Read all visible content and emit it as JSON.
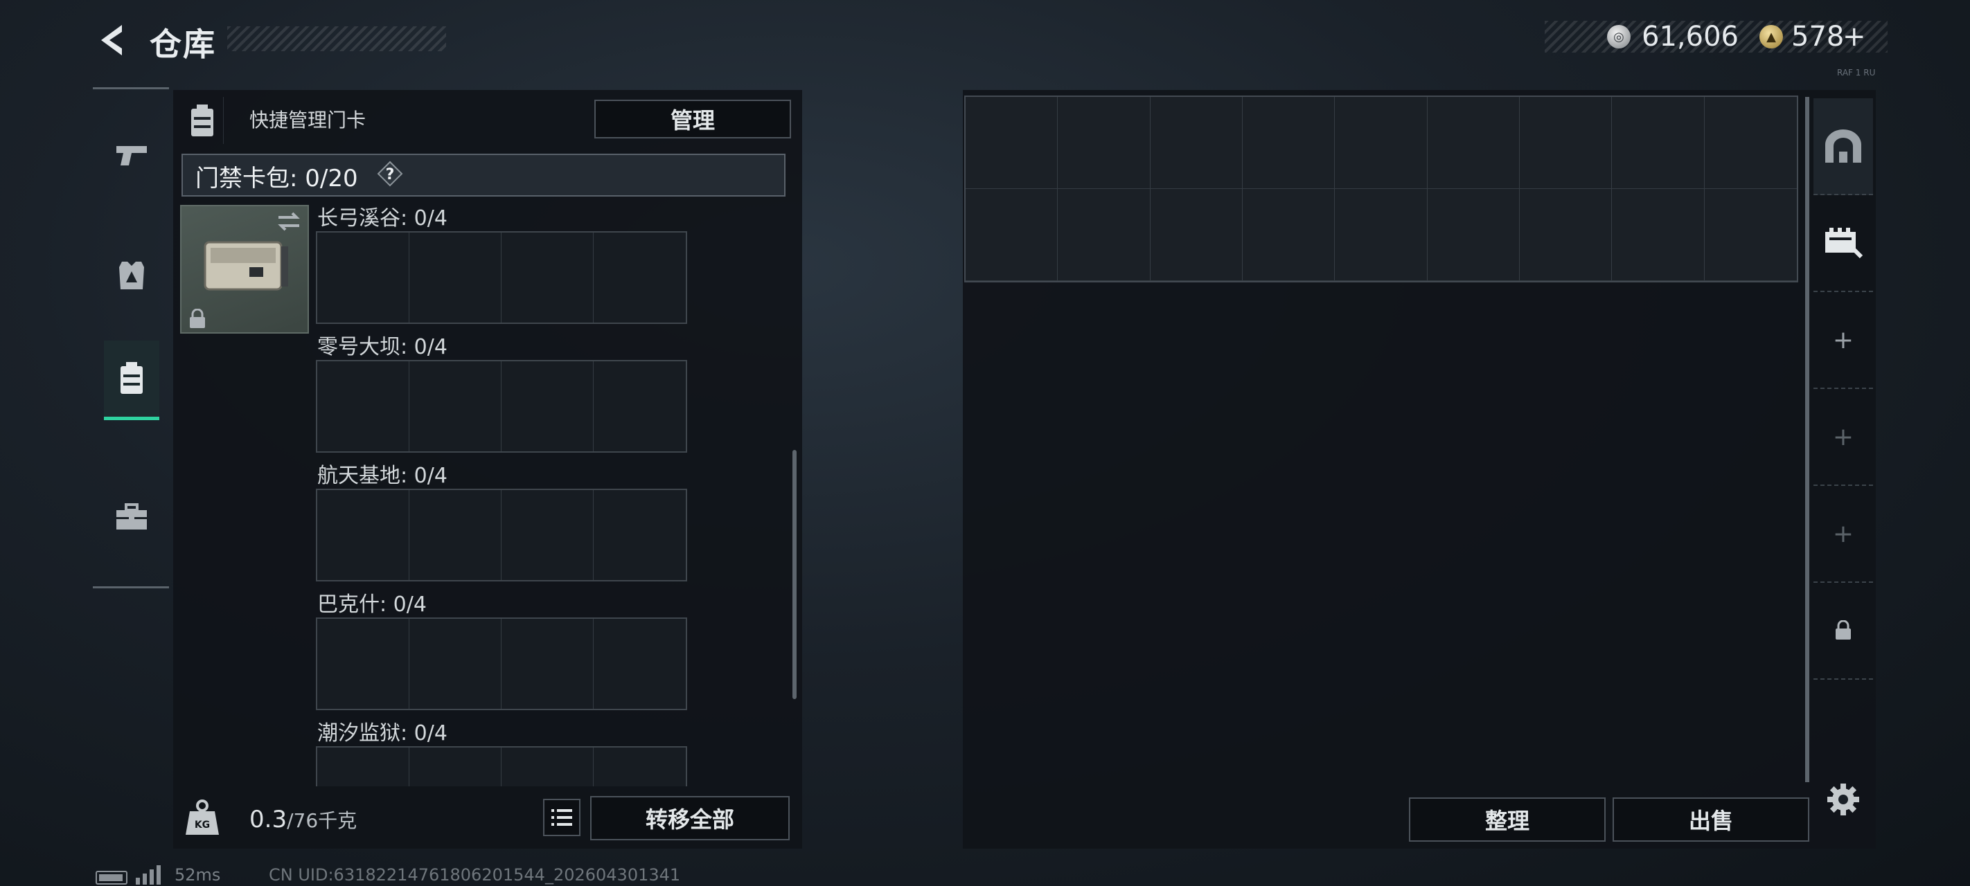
{
  "header": {
    "title": "仓库"
  },
  "currency": {
    "silver": {
      "value": "61,606",
      "icon": "silver-coin-icon"
    },
    "gold": {
      "value": "578",
      "plus_label": "+",
      "icon": "gold-coin-icon"
    },
    "tiny_label": "RAF 1 RU"
  },
  "left_nav": {
    "items": [
      {
        "icon": "pistol-icon"
      },
      {
        "icon": "vest-icon"
      },
      {
        "icon": "keycard-case-icon",
        "active": true
      },
      {
        "icon": "toolbox-icon"
      }
    ]
  },
  "keycard_panel": {
    "header_label": "快捷管理门卡",
    "manage_label": "管理",
    "pack_label": "门禁卡包: 0/20",
    "help_label": "?",
    "sections": [
      {
        "label": "长弓溪谷: 0/4"
      },
      {
        "label": "零号大坝: 0/4"
      },
      {
        "label": "航天基地: 0/4"
      },
      {
        "label": "巴克什: 0/4"
      },
      {
        "label": "潮汐监狱: 0/4"
      }
    ],
    "weight_current": "0.3",
    "weight_max": "/76千克",
    "weight_icon_label": "KG",
    "transfer_all_label": "转移全部"
  },
  "storage_panel": {
    "sort_label": "整理",
    "sell_label": "出售"
  },
  "right_nav": {
    "items": [
      {
        "icon": "storage-arch-icon"
      },
      {
        "icon": "storage-expand-icon"
      },
      {
        "icon": "plus-icon"
      },
      {
        "icon": "plus-icon"
      },
      {
        "icon": "plus-icon"
      },
      {
        "icon": "lock-icon"
      }
    ],
    "plus_label": "+"
  },
  "status_bar": {
    "ping": "52ms",
    "uid": "CN UID:6318221476180620154​4_202604301341"
  }
}
